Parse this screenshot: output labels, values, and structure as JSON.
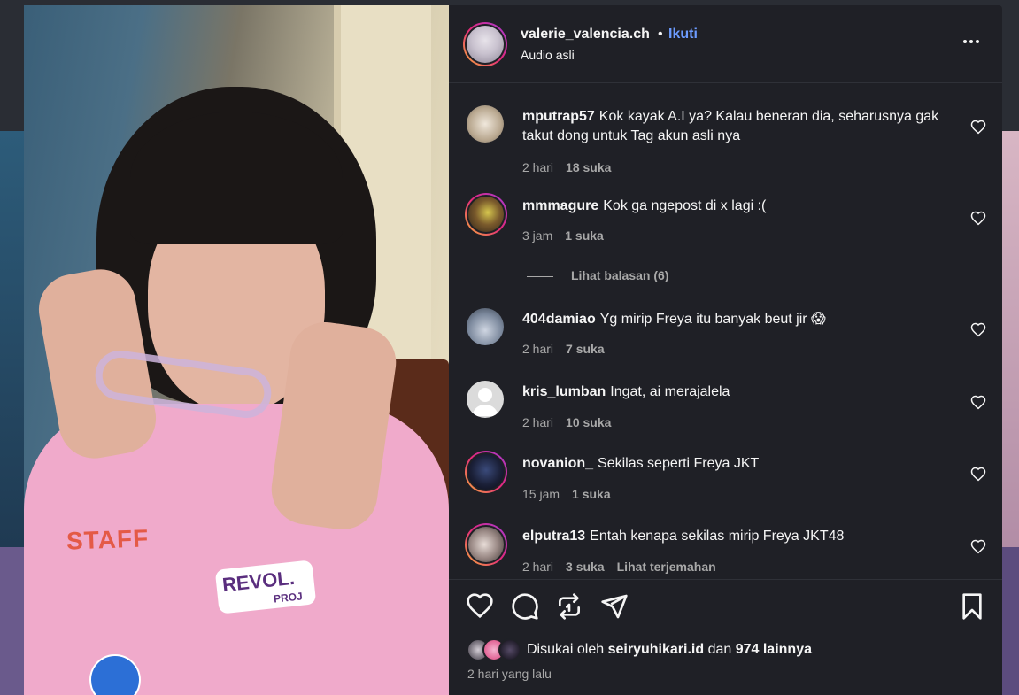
{
  "post": {
    "username": "valerie_valencia.ch",
    "dot": "•",
    "follow_label": "Ikuti",
    "audio": "Audio asli",
    "more_icon": "more-horizontal-icon"
  },
  "media": {
    "shirt_text": "STAFF",
    "shirt_logo": "REVOL.",
    "shirt_logo_sub": "PROJ"
  },
  "comments": [
    {
      "username": "mputrap57",
      "text": "Kok kayak A.I ya? Kalau beneran dia, seharusnya gak takut dong untuk Tag akun asli nya",
      "time": "2 hari",
      "likes": "18 suka"
    },
    {
      "username": "mmmagure",
      "text": "Kok ga ngepost di x lagi :(",
      "time": "3 jam",
      "likes": "1 suka",
      "replies": "Lihat balasan (6)"
    },
    {
      "username": "404damiao",
      "text": "Yg mirip Freya itu banyak beut jir 😱",
      "time": "2 hari",
      "likes": "7 suka"
    },
    {
      "username": "kris_lumban",
      "text": "Ingat, ai merajalela",
      "time": "2 hari",
      "likes": "10 suka"
    },
    {
      "username": "novanion_",
      "text": "Sekilas seperti Freya JKT",
      "time": "15 jam",
      "likes": "1 suka"
    },
    {
      "username": "elputra13",
      "text": "Entah kenapa sekilas mirip Freya JKT48",
      "time": "2 hari",
      "likes": "3 suka",
      "translate": "Lihat terjemahan"
    }
  ],
  "footer": {
    "liked_prefix": "Disukai oleh",
    "liked_user": "seiryuhikari.id",
    "liked_and": "dan",
    "liked_others": "974 lainnya",
    "date": "2 hari yang lalu"
  }
}
